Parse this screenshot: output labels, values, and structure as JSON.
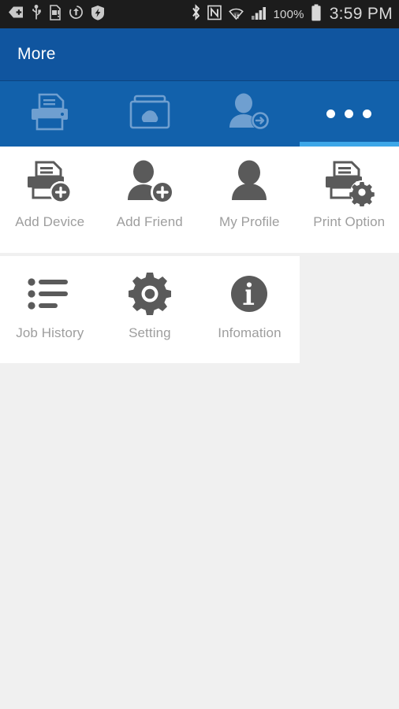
{
  "status_bar": {
    "background": "#1c1c1c",
    "left_icons": [
      {
        "name": "back-tag-icon",
        "label": "back"
      },
      {
        "name": "usb-icon",
        "label": "USB"
      },
      {
        "name": "sd-card-alert-icon",
        "label": "SD card alert"
      },
      {
        "name": "sync-icon",
        "label": "sync"
      },
      {
        "name": "shield-icon",
        "label": "security"
      }
    ],
    "right_icons": [
      {
        "name": "bluetooth-icon",
        "label": "Bluetooth"
      },
      {
        "name": "nfc-icon",
        "label": "NFC"
      },
      {
        "name": "wifi-icon",
        "label": "Wi-Fi"
      },
      {
        "name": "signal-icon",
        "label": "Signal"
      }
    ],
    "battery_percent": "100%",
    "clock": "3:59 PM"
  },
  "appbar": {
    "title": "More",
    "background": "#10559f"
  },
  "tabbar": {
    "background": "#1261ab",
    "indicator_color": "#3da7e8",
    "active_index": 3,
    "tabs": [
      {
        "icon": "printer-icon",
        "name": "tab-printer"
      },
      {
        "icon": "cloud-box-icon",
        "name": "tab-cloud"
      },
      {
        "icon": "person-add-icon",
        "name": "tab-add-person"
      },
      {
        "icon": "more-dots-icon",
        "name": "tab-more"
      }
    ]
  },
  "grid": {
    "label_color": "#9e9e9e",
    "icon_color": "#5a5a5a",
    "rows": [
      {
        "items": [
          {
            "label": "Add Device",
            "icon": "printer-add-icon"
          },
          {
            "label": "Add Friend",
            "icon": "person-add-icon"
          },
          {
            "label": "My Profile",
            "icon": "person-icon"
          },
          {
            "label": "Print Option",
            "icon": "printer-gear-icon"
          }
        ]
      },
      {
        "items": [
          {
            "label": "Job History",
            "icon": "list-icon"
          },
          {
            "label": "Setting",
            "icon": "gear-icon"
          },
          {
            "label": "Infomation",
            "icon": "info-icon"
          }
        ]
      }
    ]
  },
  "page": {
    "background": "#f0f0f0"
  }
}
